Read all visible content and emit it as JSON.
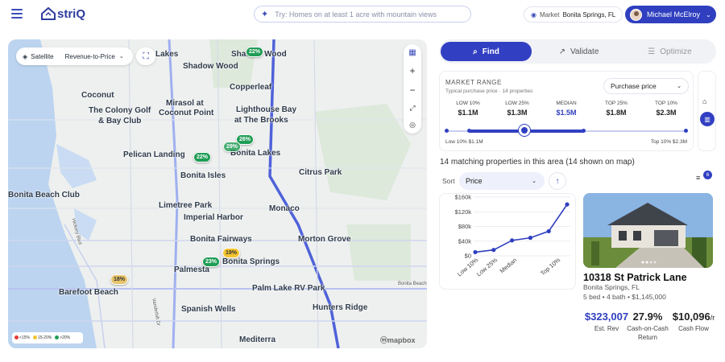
{
  "header": {
    "logo_text": "striQ",
    "search_placeholder": "Try: Homes on at least 1 acre with mountain views",
    "market_label": "Market",
    "market_value": "Bonita Springs, FL",
    "user_name": "Michael McElroy"
  },
  "map": {
    "layer_label": "Satellite",
    "metric_label": "Revenue-to-Price",
    "labels": [
      "Lakes",
      "Shadow Wood",
      "Shadow Wood",
      "Copperleaf",
      "Coconut",
      "Mirasol at",
      "Coconut Point",
      "Lighthouse Bay",
      "at The Brooks",
      "The Colony Golf",
      "& Bay Club",
      "Pelican Landing",
      "Bonita Lakes",
      "Bonita Isles",
      "Citrus Park",
      "Bonita Beach Club",
      "Limetree Park",
      "Monaco",
      "Imperial Harbor",
      "Bonita Fairways",
      "Morton Grove",
      "Bonita Springs",
      "Palmesta",
      "Palm Lake RV Park",
      "Barefoot Beach",
      "Spanish Wells",
      "Hunters Ridge",
      "Mediterra"
    ],
    "small_labels": [
      "Bonita Beach",
      "Hickory Blvd",
      "Vanderbilt Dr"
    ],
    "pins": [
      "22%",
      "26%",
      "22%",
      "29%",
      "23%",
      "19%",
      "18%"
    ],
    "legend": [
      "<15%",
      "15-20%",
      ">20%"
    ],
    "legend_colors": [
      "#e53935",
      "#f4c430",
      "#1f9d55"
    ],
    "attribution": "mapbox"
  },
  "tabs": [
    {
      "label": "Find",
      "icon": "search-icon",
      "active": true
    },
    {
      "label": "Validate",
      "icon": "trend-icon",
      "active": false
    },
    {
      "label": "Optimize",
      "icon": "sliders-icon",
      "active": false
    }
  ],
  "market_range": {
    "heading": "MARKET RANGE",
    "subheading": "Typical purchase price · 14 properties",
    "selector": "Purchase price",
    "percentiles": [
      {
        "label": "LOW 10%",
        "value": "$1.1M"
      },
      {
        "label": "LOW 25%",
        "value": "$1.3M"
      },
      {
        "label": "MEDIAN",
        "value": "$1.5M"
      },
      {
        "label": "TOP 25%",
        "value": "$1.8M"
      },
      {
        "label": "TOP 10%",
        "value": "$2.3M"
      }
    ],
    "low_text": "Low 10% $1.1M",
    "high_text": "Top 10% $2.3M"
  },
  "results": {
    "count_text": "14 matching properties in this area (14 shown on map)",
    "sort_label": "Sort",
    "sort_value": "Price",
    "filter_badge": "6"
  },
  "chart_data": {
    "type": "line",
    "categories": [
      "Low 10%",
      "Low 25%",
      "Median",
      "Top 10%"
    ],
    "x": [
      0,
      1,
      2,
      3,
      4,
      5
    ],
    "values": [
      10,
      16,
      42,
      49,
      67,
      140
    ],
    "ylim": [
      0,
      160
    ],
    "yticks": [
      "$0",
      "$20k",
      "$40k",
      "$60k",
      "$80k",
      "$100k",
      "$120k",
      "$140k",
      "$160k"
    ],
    "grid": true
  },
  "property": {
    "address": "10318 St Patrick Lane",
    "city": "Bonita Springs, FL",
    "specs": "5 bed • 4 bath • $1,145,000",
    "stats": [
      {
        "value": "$323,007",
        "label": "Est. Rev"
      },
      {
        "value": "27.9%",
        "label": "Cash-on-Cash Return"
      },
      {
        "value": "$10,096",
        "label": "Cash Flow",
        "suffix": "/r"
      }
    ]
  }
}
